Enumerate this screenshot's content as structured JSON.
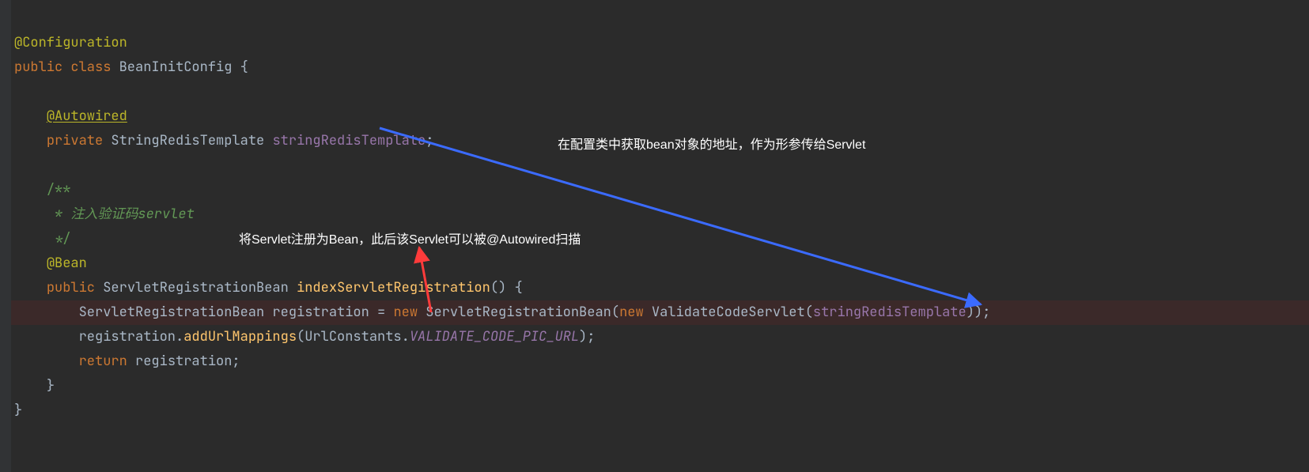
{
  "annotations": {
    "top": "在配置类中获取bean对象的地址，作为形参传给Servlet",
    "bottom": "将Servlet注册为Bean，此后该Servlet可以被@Autowired扫描"
  },
  "code": {
    "l1_ann": "@Configuration",
    "l2_kw_public": "public",
    "l2_kw_class": "class",
    "l2_name": "BeanInitConfig",
    "l2_brace": "{",
    "l4_ann": "@Autowired",
    "l5_kw_private": "private",
    "l5_type": "StringRedisTemplate",
    "l5_field": "stringRedisTemplate",
    "l5_semi": ";",
    "l7_doc": "/**",
    "l8_doc": " * 注入验证码servlet",
    "l9_doc": " */",
    "l10_ann": "@Bean",
    "l11_kw_public": "public",
    "l11_type": "ServletRegistrationBean",
    "l11_method": "indexServletRegistration",
    "l11_paren": "()",
    "l11_brace": "{",
    "l12_type": "ServletRegistrationBean",
    "l12_var": "registration",
    "l12_eq": "=",
    "l12_new1": "new",
    "l12_ctor1": "ServletRegistrationBean",
    "l12_paren1": "(",
    "l12_new2": "new",
    "l12_ctor2": "ValidateCodeServlet",
    "l12_paren2": "(",
    "l12_arg": "stringRedisTemplate",
    "l12_close": "));",
    "l13_var": "registration",
    "l13_dot": ".",
    "l13_call": "addUrlMappings",
    "l13_paren": "(",
    "l13_cls": "UrlConstants",
    "l13_dot2": ".",
    "l13_const": "VALIDATE_CODE_PIC_URL",
    "l13_close": ");",
    "l14_kw_return": "return",
    "l14_var": "registration",
    "l14_semi": ";",
    "l15_brace": "}",
    "l16_brace": "}"
  }
}
